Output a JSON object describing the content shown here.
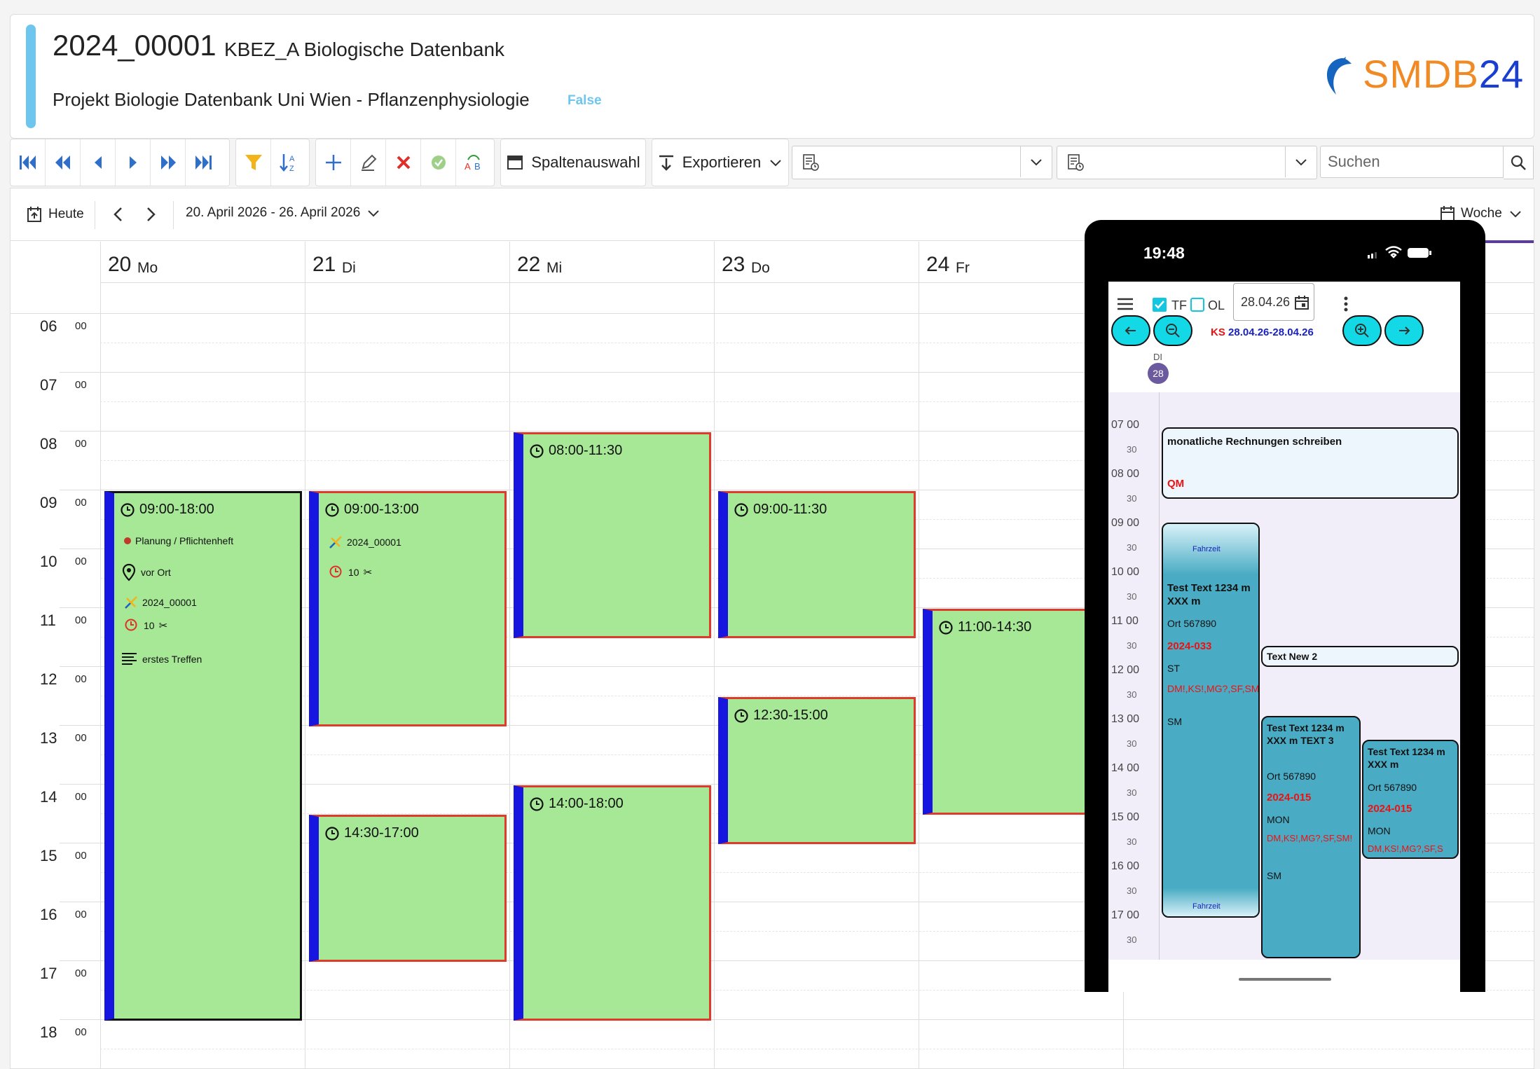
{
  "header": {
    "record_id": "2024_00001",
    "record_name": "KBEZ_A Biologische Datenbank",
    "project": "Projekt Biologie Datenbank Uni Wien - Pflanzenphysiologie",
    "flag": "False",
    "logo_text": "SMDB",
    "logo_number": "24",
    "accent_color": "#6ec6ef"
  },
  "toolbar": {
    "nav_icons": [
      "first-page-icon",
      "previous-page-icon",
      "previous-icon",
      "next-icon",
      "next-page-icon",
      "last-page-icon"
    ],
    "filter_icons": [
      "filter-icon",
      "sort-icon"
    ],
    "edit_icons": [
      "add-icon",
      "edit-icon",
      "delete-icon",
      "confirm-icon",
      "spell-icon"
    ],
    "columns_label": "Spaltenauswahl",
    "export_label": "Exportieren",
    "search_placeholder": "Suchen"
  },
  "calendar": {
    "today_label": "Heute",
    "range_label": "20. April 2026 - 26. April 2026",
    "view_label": "Woche",
    "days": [
      {
        "num": "20",
        "name": "Mo"
      },
      {
        "num": "21",
        "name": "Di"
      },
      {
        "num": "22",
        "name": "Mi"
      },
      {
        "num": "23",
        "name": "Do"
      },
      {
        "num": "24",
        "name": "Fr"
      }
    ],
    "hours": [
      "06",
      "07",
      "08",
      "09",
      "10",
      "11",
      "12",
      "13",
      "14",
      "15",
      "16",
      "17",
      "18"
    ],
    "minutes": "00",
    "events": [
      {
        "time": "09:00-18:00",
        "lines": [
          "Planung / Pflichtenheft",
          "vor Ort",
          "2024_00001",
          "10",
          "erstes Treffen"
        ]
      },
      {
        "time": "09:00-13:00",
        "lines": [
          "2024_00001",
          "10"
        ]
      },
      {
        "time": "14:30-17:00"
      },
      {
        "time": "08:00-11:30"
      },
      {
        "time": "14:00-18:00"
      },
      {
        "time": "09:00-11:30"
      },
      {
        "time": "12:30-15:00"
      },
      {
        "time": "11:00-14:30"
      }
    ],
    "colors": {
      "event_fill": "#a6e896",
      "event_border": "#e23a2a",
      "event_stripe": "#1616e0"
    }
  },
  "phone": {
    "clock": "19:48",
    "tf_label": "TF",
    "ol_label": "OL",
    "date_value": "28.04.26",
    "range_prefix": "KS",
    "range_value": "28.04.26-28.04.26",
    "day_name": "DI",
    "day_num": "28",
    "hours": [
      "07 00",
      "08 00",
      "09 00",
      "10 00",
      "11 00",
      "12 00",
      "13 00",
      "14 00",
      "15 00",
      "16 00",
      "17 00"
    ],
    "half": "30",
    "card1": {
      "title": "monatliche Rechnungen schreiben",
      "tag": "QM"
    },
    "card2": {
      "top": "Fahrzeit",
      "title": "Test Text 1234 m XXX m",
      "ort": "Ort 567890",
      "code": "2024-033",
      "st": "ST",
      "codes": "DM!,KS!,MG?,SF,SMx",
      "sm": "SM",
      "bottom": "Fahrzeit"
    },
    "card3": {
      "title": "Text New 2"
    },
    "card4": {
      "title": "Test Text 1234 m XXX m TEXT 3",
      "ort": "Ort 567890",
      "code": "2024-015",
      "day": "MON",
      "codes": "DM,KS!,MG?,SF,SM!",
      "sm": "SM"
    },
    "card5": {
      "title": "Test Text 1234 m XXX m",
      "ort": "Ort 567890",
      "code": "2024-015",
      "day": "MON",
      "codes": "DM,KS!,MG?,SF,S"
    },
    "accent_color": "#13d9e6"
  }
}
